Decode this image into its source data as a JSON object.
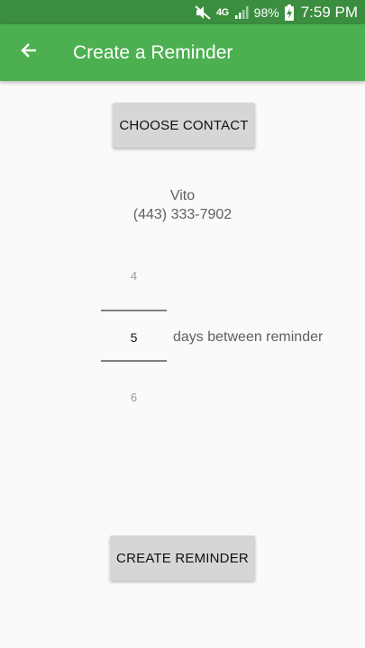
{
  "status_bar": {
    "network": "4G",
    "battery": "98%",
    "time": "7:59 PM",
    "icons": [
      "mute-icon",
      "signal-icon",
      "battery-charging-icon"
    ]
  },
  "app_bar": {
    "title": "Create a Reminder",
    "back_icon": "arrow-back-icon",
    "color": "#4caf50"
  },
  "choose_contact_label": "CHOOSE CONTACT",
  "contact": {
    "name": "Vito",
    "phone": "(443) 333-7902"
  },
  "picker": {
    "previous": "4",
    "current": "5",
    "next": "6",
    "label": "days between reminder"
  },
  "create_reminder_label": "CREATE REMINDER"
}
